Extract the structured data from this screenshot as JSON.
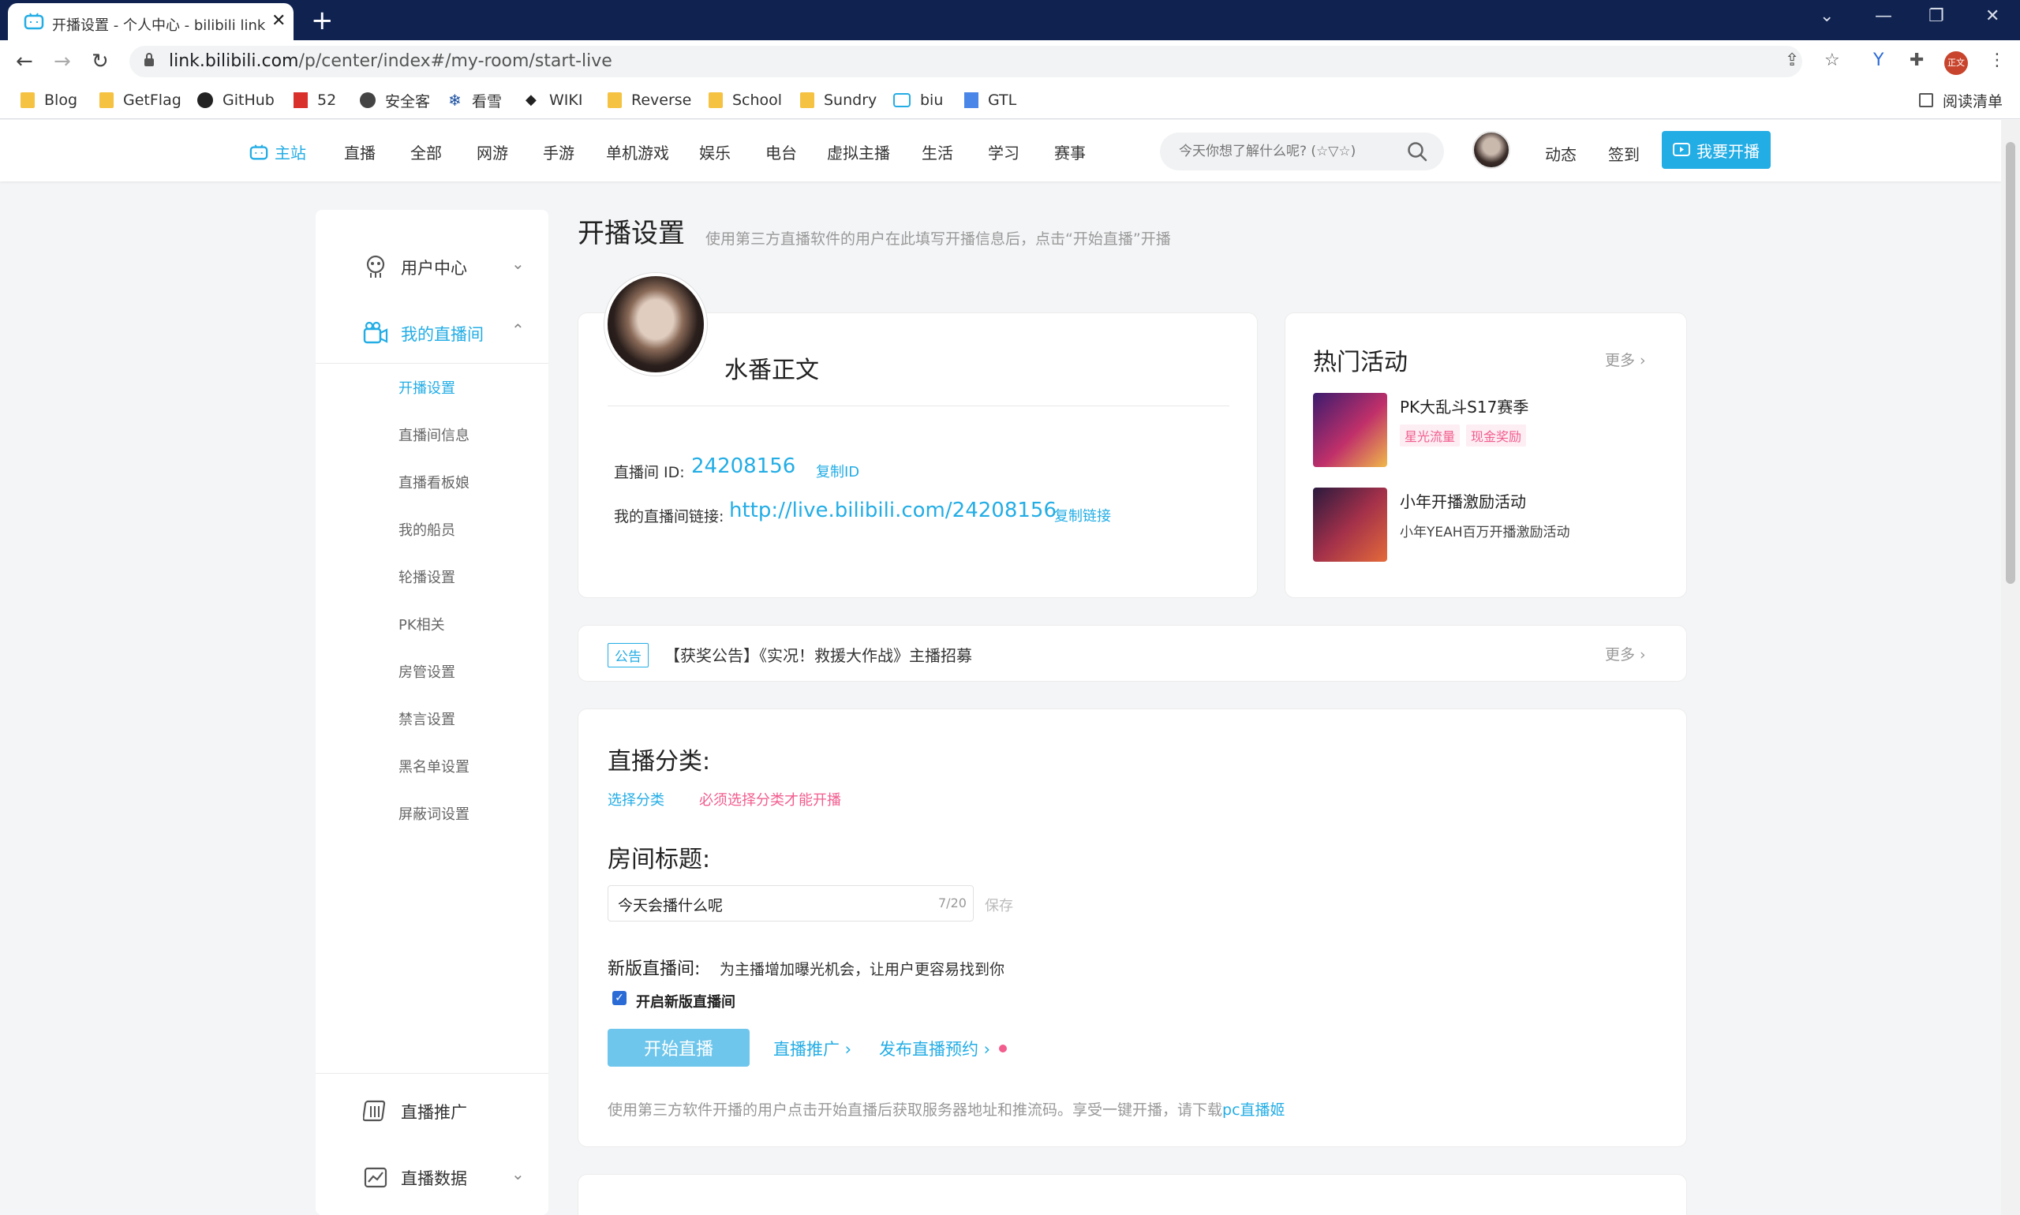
{
  "browser": {
    "tab_title": "开播设置 - 个人中心 - bilibili link",
    "url_host": "link.bilibili.com",
    "url_path": "/p/center/index#/my-room/start-live",
    "profile_badge": "正文",
    "new_tab": "+",
    "close_tab": "✕",
    "win_controls": [
      "⌄",
      "—",
      "❐",
      "✕"
    ]
  },
  "bookmarks": [
    {
      "label": "Blog",
      "icon": "folder-icon"
    },
    {
      "label": "GetFlag",
      "icon": "folder-icon"
    },
    {
      "label": "GitHub",
      "icon": "github-icon"
    },
    {
      "label": "52",
      "icon": "52pojie-icon"
    },
    {
      "label": "安全客",
      "icon": "globe-icon"
    },
    {
      "label": "看雪",
      "icon": "snowflake-icon"
    },
    {
      "label": "WIKI",
      "icon": "wiki-icon"
    },
    {
      "label": "Reverse",
      "icon": "folder-icon"
    },
    {
      "label": "School",
      "icon": "folder-icon"
    },
    {
      "label": "Sundry",
      "icon": "folder-icon"
    },
    {
      "label": "biu",
      "icon": "bilibili-icon"
    },
    {
      "label": "GTL",
      "icon": "translate-icon"
    }
  ],
  "reading_list": "阅读清单",
  "nav": {
    "home": "主站",
    "items": [
      "直播",
      "全部",
      "网游",
      "手游",
      "单机游戏",
      "娱乐",
      "电台",
      "虚拟主播",
      "生活",
      "学习",
      "赛事"
    ],
    "search_placeholder": "今天你想了解什么呢? (☆▽☆)",
    "dynamic": "动态",
    "checkin": "签到",
    "go_live": "我要开播"
  },
  "sidebar": {
    "user_center": "用户中心",
    "my_room": "我的直播间",
    "sub_items": [
      "开播设置",
      "直播间信息",
      "直播看板娘",
      "我的船员",
      "轮播设置",
      "PK相关",
      "房管设置",
      "禁言设置",
      "黑名单设置",
      "屏蔽词设置"
    ],
    "promotion": "直播推广",
    "data": "直播数据"
  },
  "main": {
    "title": "开播设置",
    "description": "使用第三方直播软件的用户在此填写开播信息后，点击“开始直播”开播",
    "username": "水番正文",
    "room_id_label": "直播间 ID:",
    "room_id": "24208156",
    "copy_id": "复制ID",
    "room_link_label": "我的直播间链接:",
    "room_link": "http://live.bilibili.com/24208156",
    "copy_link": "复制链接"
  },
  "hot": {
    "title": "热门活动",
    "more": "更多",
    "activities": [
      {
        "title": "PK大乱斗S17赛季",
        "tags": [
          "星光流量",
          "现金奖励"
        ]
      },
      {
        "title": "小年开播激励活动",
        "subtitle": "小年YEAH百万开播激励活动"
      }
    ]
  },
  "notice": {
    "tag": "公告",
    "text": "【获奖公告】《实况！救援大作战》主播招募",
    "more": "更多"
  },
  "settings": {
    "category_title": "直播分类:",
    "choose_category": "选择分类",
    "category_warning": "必须选择分类才能开播",
    "room_title_label": "房间标题:",
    "room_title_value": "今天会播什么呢",
    "room_title_count": "7/20",
    "save": "保存",
    "new_room_label": "新版直播间:",
    "new_room_desc": "为主播增加曝光机会，让用户更容易找到你",
    "new_room_checkbox": "开启新版直播间",
    "new_room_checked": true,
    "start_live": "开始直播",
    "promotion_link": "直播推广",
    "schedule_link": "发布直播预约",
    "footer_hint": "使用第三方软件开播的用户点击开始直播后获取服务器地址和推流码。享受一键开播，请下载",
    "footer_link": "pc直播姬"
  },
  "colors": {
    "accent": "#23ade5",
    "pink": "#f25d8e",
    "tab_strip": "#0f2250"
  }
}
